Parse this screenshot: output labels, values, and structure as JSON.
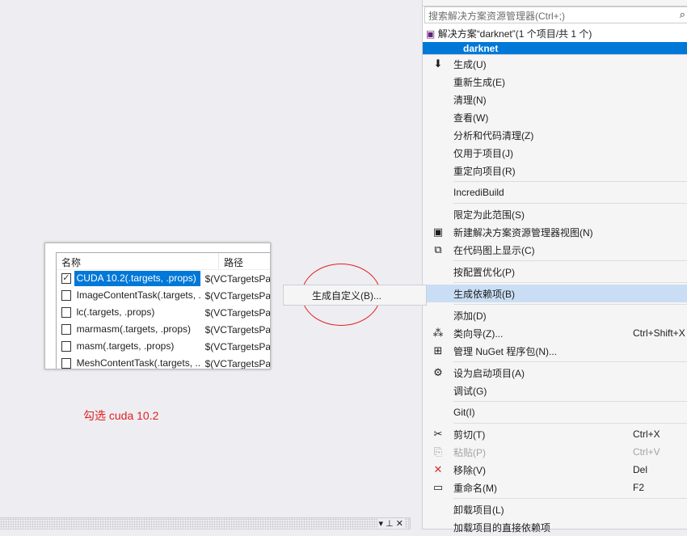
{
  "solution_explorer": {
    "search_placeholder": "搜索解决方案资源管理器(Ctrl+;)",
    "solution_label": "解决方案“darknet”(1 个项目/共 1 个)",
    "project": "darknet"
  },
  "context_menu": [
    {
      "label": "生成(U)",
      "icon": "build-icon",
      "glyph": "⬇"
    },
    {
      "label": "重新生成(E)"
    },
    {
      "label": "清理(N)"
    },
    {
      "label": "查看(W)"
    },
    {
      "label": "分析和代码清理(Z)"
    },
    {
      "label": "仅用于项目(J)"
    },
    {
      "label": "重定向项目(R)"
    },
    {
      "sep": true
    },
    {
      "label": "IncrediBuild"
    },
    {
      "sep": true
    },
    {
      "label": "限定为此范围(S)"
    },
    {
      "label": "新建解决方案资源管理器视图(N)",
      "icon": "new-view-icon",
      "glyph": "▣"
    },
    {
      "label": "在代码图上显示(C)",
      "icon": "code-map-icon",
      "glyph": "⧉"
    },
    {
      "sep": true
    },
    {
      "label": "按配置优化(P)"
    },
    {
      "sep": true
    },
    {
      "label": "生成依赖项(B)",
      "highlight": true
    },
    {
      "sep": true
    },
    {
      "label": "添加(D)"
    },
    {
      "label": "类向导(Z)...",
      "icon": "class-wizard-icon",
      "glyph": "⁂",
      "shortcut": "Ctrl+Shift+X"
    },
    {
      "label": "管理 NuGet 程序包(N)...",
      "icon": "nuget-icon",
      "glyph": "⊞"
    },
    {
      "sep": true
    },
    {
      "label": "设为启动项目(A)",
      "icon": "gear-icon",
      "glyph": "⚙"
    },
    {
      "label": "调试(G)"
    },
    {
      "sep": true
    },
    {
      "label": "Git(I)"
    },
    {
      "sep": true
    },
    {
      "label": "剪切(T)",
      "icon": "scissors-icon",
      "glyph": "✂",
      "shortcut": "Ctrl+X"
    },
    {
      "label": "粘贴(P)",
      "icon": "paste-icon",
      "glyph": "⎘",
      "shortcut": "Ctrl+V",
      "disabled": true
    },
    {
      "label": "移除(V)",
      "icon": "remove-icon",
      "glyph": "✕",
      "shortcut": "Del",
      "color": "#d32f2f"
    },
    {
      "label": "重命名(M)",
      "icon": "rename-icon",
      "glyph": "▭",
      "shortcut": "F2"
    },
    {
      "sep": true
    },
    {
      "label": "卸载项目(L)"
    },
    {
      "label": "加载项目的直接依赖项"
    }
  ],
  "submenu": {
    "label": "生成自定义(B)..."
  },
  "dialog": {
    "col_name": "名称",
    "col_path": "路径",
    "rows": [
      {
        "name": "CUDA 10.2(.targets, .props)",
        "path": "$(VCTargetsPath)",
        "checked": true
      },
      {
        "name": "ImageContentTask(.targets, ....",
        "path": "$(VCTargetsPath)",
        "checked": false
      },
      {
        "name": "lc(.targets, .props)",
        "path": "$(VCTargetsPath)",
        "checked": false
      },
      {
        "name": "marmasm(.targets, .props)",
        "path": "$(VCTargetsPath)",
        "checked": false
      },
      {
        "name": "masm(.targets, .props)",
        "path": "$(VCTargetsPath)",
        "checked": false
      },
      {
        "name": "MeshContentTask(.targets, ....",
        "path": "$(VCTargetsPath)",
        "checked": false
      }
    ]
  },
  "annotation": "勾选 cuda 10.2",
  "colors": {
    "accent": "#0078d7",
    "annotation": "#e02020",
    "highlight": "#c9def5"
  }
}
